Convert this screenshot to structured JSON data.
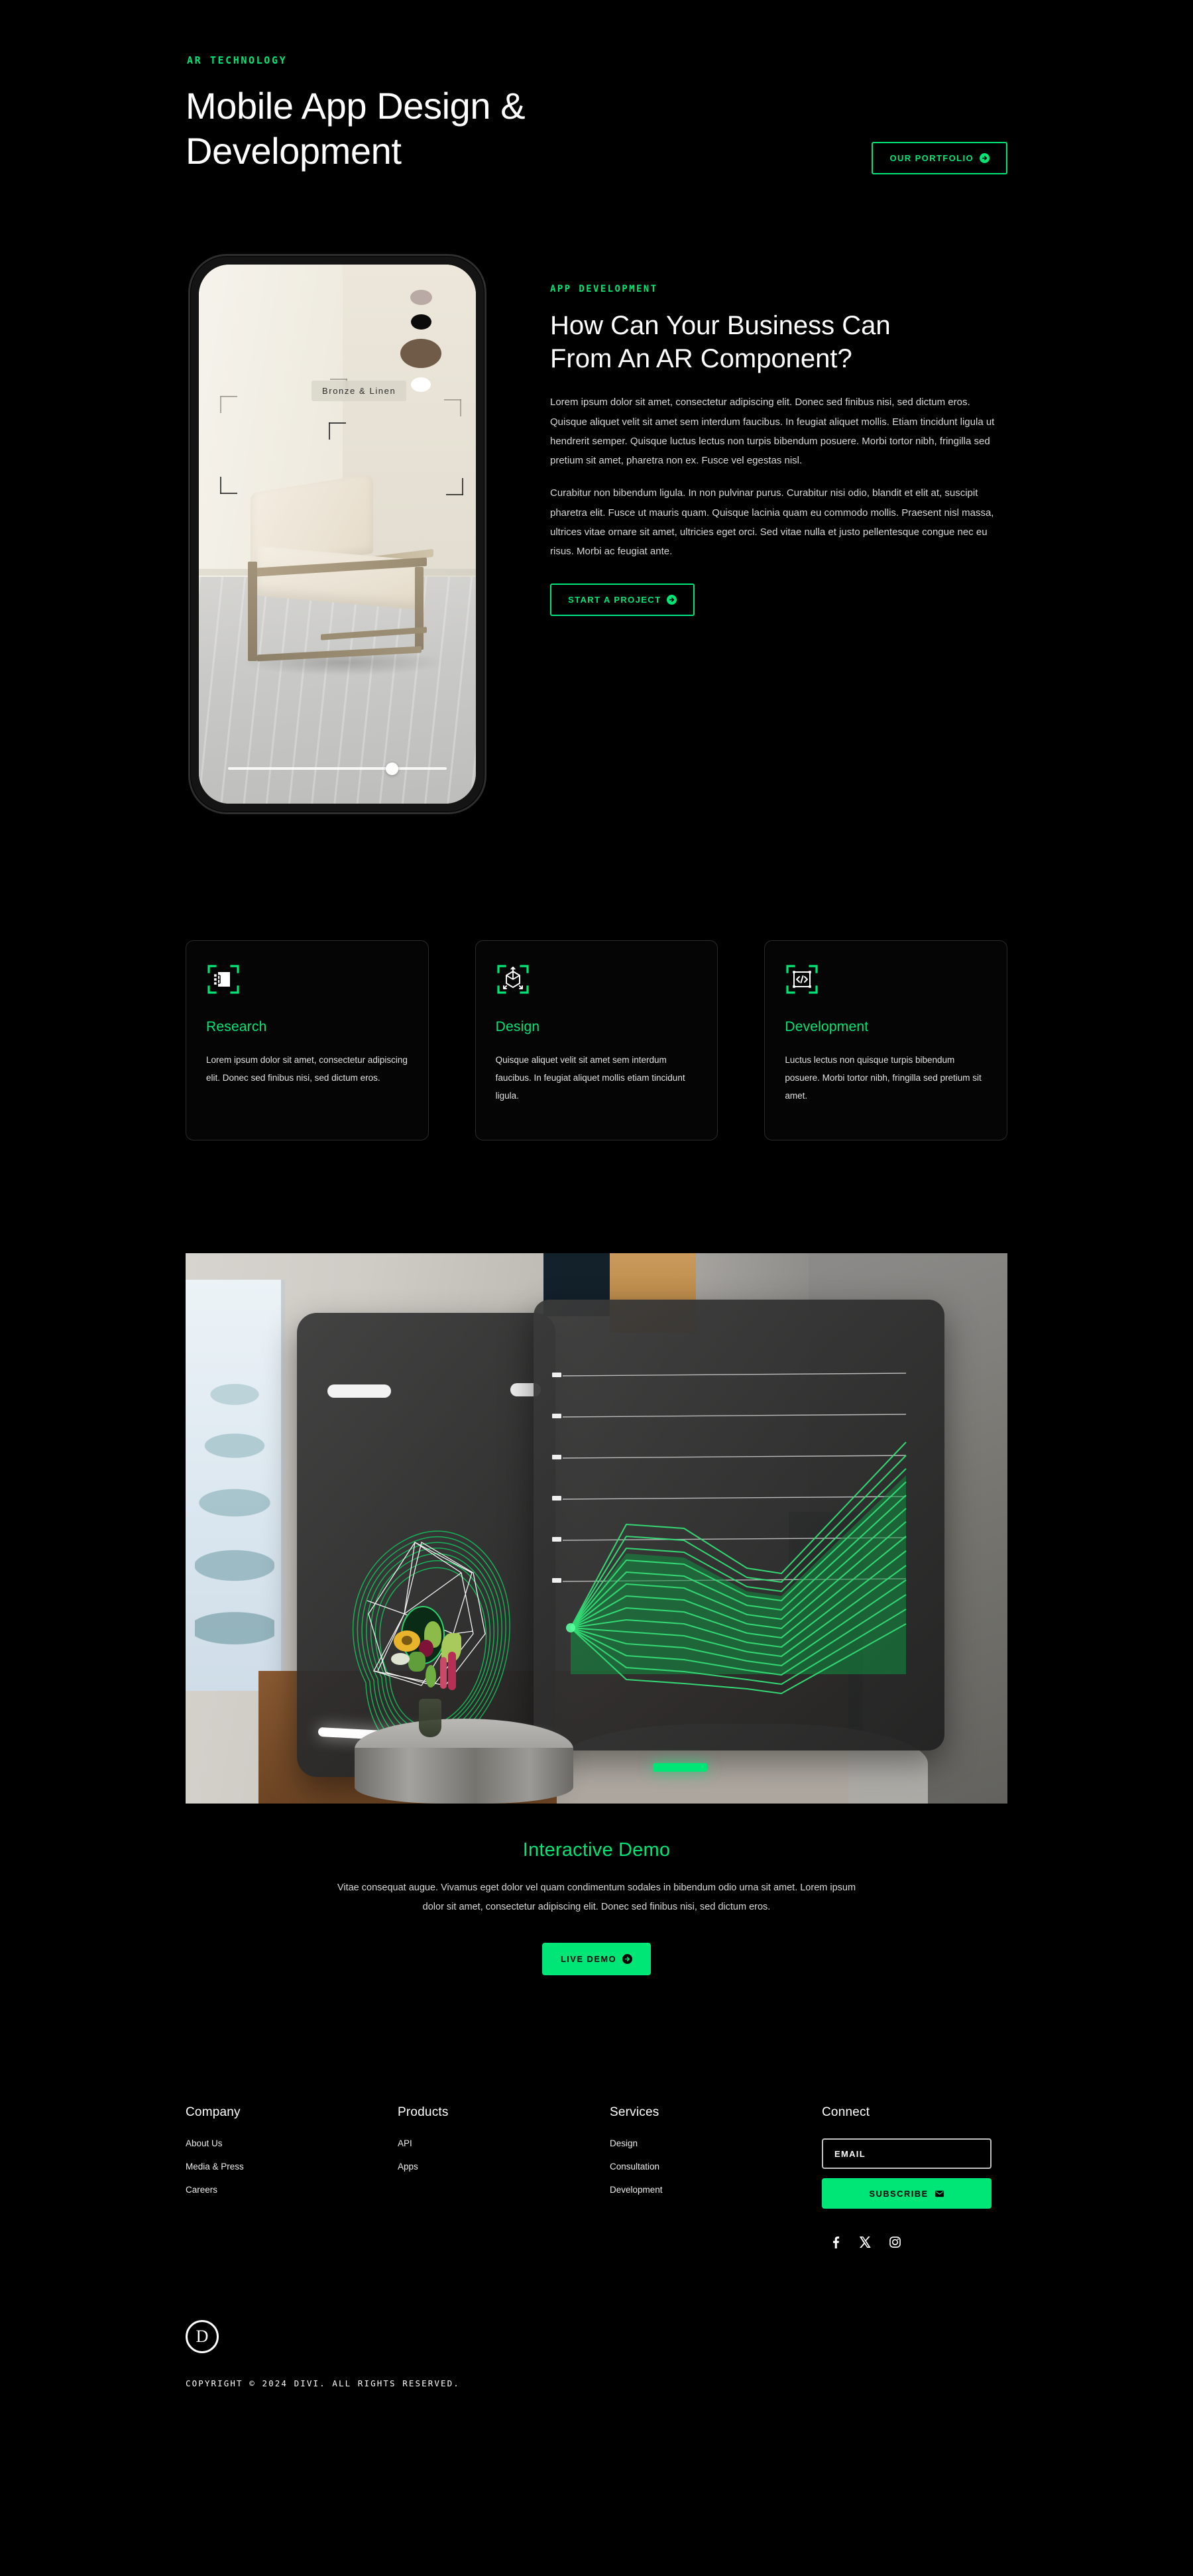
{
  "hero": {
    "eyebrow": "AR TECHNOLOGY",
    "title_line1": "Mobile App Design &",
    "title_line2": "Development",
    "cta_label": "OUR PORTFOLIO"
  },
  "phone": {
    "product_label": "Bronze & Linen",
    "swatches": [
      "#b9aaa5",
      "#0b0b0b",
      "#6f5b47",
      "#ffffff"
    ],
    "slider_position_percent": 72
  },
  "section2": {
    "kicker": "APP DEVELOPMENT",
    "heading_line1": "How Can Your Business Can",
    "heading_line2": "From An AR Component?",
    "paragraph1": "Lorem ipsum dolor sit amet, consectetur adipiscing elit. Donec sed finibus nisi, sed dictum eros. Quisque aliquet velit sit amet sem interdum faucibus. In feugiat aliquet mollis. Etiam tincidunt ligula ut hendrerit semper. Quisque luctus lectus non turpis bibendum posuere. Morbi tortor nibh, fringilla sed pretium sit amet, pharetra non ex. Fusce vel egestas nisl.",
    "paragraph2": "Curabitur non bibendum ligula. In non pulvinar purus. Curabitur nisi odio, blandit et elit at, suscipit pharetra elit. Fusce ut mauris quam. Quisque lacinia quam eu commodo mollis. Praesent nisl massa, ultrices vitae ornare sit amet, ultricies eget orci. Sed vitae nulla et justo pellentesque congue nec eu risus. Morbi ac feugiat ante.",
    "cta_label": "START A PROJECT"
  },
  "cards": [
    {
      "icon": "scan-flowchart-icon",
      "title": "Research",
      "text": "Lorem ipsum dolor sit amet, consectetur adipiscing elit. Donec sed finibus nisi, sed dictum eros."
    },
    {
      "icon": "scan-3d-cube-icon",
      "title": "Design",
      "text": "Quisque aliquet velit sit amet sem interdum faucibus. In feugiat aliquet mollis etiam tincidunt ligula."
    },
    {
      "icon": "scan-code-icon",
      "title": "Development",
      "text": "Luctus lectus non quisque turpis bibendum posuere. Morbi tortor nibh, fringilla sed pretium sit amet."
    }
  ],
  "demo": {
    "title": "Interactive Demo",
    "text": "Vitae consequat augue. Vivamus eget dolor vel quam condimentum sodales in bibendum odio urna sit amet. Lorem ipsum dolor sit amet, consectetur adipiscing elit. Donec sed finibus nisi, sed dictum eros.",
    "cta_label": "LIVE DEMO"
  },
  "footer": {
    "columns": [
      {
        "heading": "Company",
        "links": [
          "About Us",
          "Media & Press",
          "Careers"
        ]
      },
      {
        "heading": "Products",
        "links": [
          "API",
          "Apps"
        ]
      },
      {
        "heading": "Services",
        "links": [
          "Design",
          "Consultation",
          "Development"
        ]
      }
    ],
    "connect": {
      "heading": "Connect",
      "email_placeholder": "EMAIL",
      "email_value": "",
      "subscribe_label": "SUBSCRIBE",
      "socials": [
        "facebook-icon",
        "x-twitter-icon",
        "instagram-icon"
      ]
    }
  },
  "bottom": {
    "logo_letter": "D",
    "copyright": "COPYRIGHT © 2024 DIVI. ALL RIGHTS RESERVED."
  },
  "colors": {
    "accent": "#00e676",
    "background": "#000000",
    "text": "#ffffff",
    "muted": "#d9d9d9",
    "card_border": "#2a2a2a"
  },
  "chart_data": {
    "type": "line",
    "title": "",
    "xlabel": "",
    "ylabel": "",
    "grid": true,
    "legend": "none",
    "x": [
      0,
      1,
      2,
      3,
      4,
      5
    ],
    "gridline_count": 6,
    "series": [
      {
        "name": "s1",
        "values": [
          50,
          79,
          79,
          67,
          66,
          95
        ]
      },
      {
        "name": "s2",
        "values": [
          50,
          75,
          75,
          64,
          63,
          91
        ]
      },
      {
        "name": "s3",
        "values": [
          50,
          71,
          71,
          61,
          60,
          87
        ]
      },
      {
        "name": "s4",
        "values": [
          50,
          67,
          67,
          58,
          57,
          83
        ]
      },
      {
        "name": "s5",
        "values": [
          50,
          63,
          63,
          55,
          54,
          79
        ]
      },
      {
        "name": "s6",
        "values": [
          50,
          59,
          59,
          52,
          51,
          75
        ]
      },
      {
        "name": "s7",
        "values": [
          50,
          55,
          55,
          49,
          48,
          71
        ]
      },
      {
        "name": "s8",
        "values": [
          50,
          51,
          51,
          46,
          45,
          67
        ]
      },
      {
        "name": "s9",
        "values": [
          50,
          47,
          47,
          43,
          42,
          63
        ]
      },
      {
        "name": "s10",
        "values": [
          50,
          43,
          43,
          40,
          39,
          59
        ]
      },
      {
        "name": "s11",
        "values": [
          50,
          39,
          39,
          37,
          36,
          55
        ]
      },
      {
        "name": "s12",
        "values": [
          50,
          35,
          35,
          34,
          33,
          51
        ]
      },
      {
        "name": "s13",
        "values": [
          50,
          31,
          31,
          31,
          30,
          47
        ]
      },
      {
        "name": "s14",
        "values": [
          50,
          27,
          27,
          28,
          27,
          43
        ]
      }
    ],
    "ylim": [
      0,
      100
    ],
    "series_color": "#2fd46e"
  }
}
